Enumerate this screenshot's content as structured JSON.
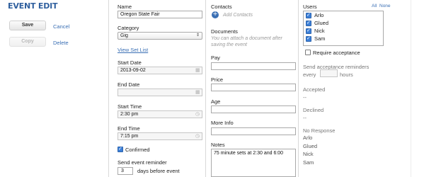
{
  "header": {
    "title": "EVENT EDIT"
  },
  "actions": {
    "save_label": "Save",
    "cancel_label": "Cancel",
    "copy_label": "Copy",
    "delete_label": "Delete"
  },
  "form": {
    "name_label": "Name",
    "name_value": "Oregon State Fair",
    "category_label": "Category",
    "category_value": "Gig",
    "view_set_list": "View Set List",
    "start_date_label": "Start Date",
    "start_date_value": "2013-09-02",
    "end_date_label": "End Date",
    "end_date_value": "",
    "start_time_label": "Start Time",
    "start_time_value": "2:30 pm",
    "end_time_label": "End Time",
    "end_time_value": "7:15 pm",
    "confirmed_label": "Confirmed",
    "confirmed_checked": true,
    "reminder_label": "Send event reminder",
    "reminder_days_value": "3",
    "reminder_suffix": "days before event"
  },
  "middle": {
    "contacts_label": "Contacts",
    "add_contacts": "Add Contacts",
    "documents_label": "Documents",
    "documents_hint_1": "You can attach a document after",
    "documents_hint_2": "saving the event",
    "pay_label": "Pay",
    "price_label": "Price",
    "age_label": "Age",
    "more_info_label": "More Info",
    "notes_label": "Notes",
    "notes_value": "75 minute sets at 2:30 and 6:00"
  },
  "users": {
    "label": "Users",
    "all_link": "All",
    "none_link": "None",
    "list": [
      {
        "name": "Arlo",
        "checked": true
      },
      {
        "name": "Glued",
        "checked": true
      },
      {
        "name": "Nick",
        "checked": true
      },
      {
        "name": "Sam",
        "checked": true
      }
    ],
    "require_acceptance_label": "Require acceptance",
    "send_reminders_label": "Send acceptance reminders",
    "every_label": "every",
    "hours_label": "hours",
    "accepted_label": "Accepted",
    "accepted_value": "--",
    "declined_label": "Declined",
    "declined_value": "--",
    "no_response_label": "No Response",
    "no_response_names": [
      "Arlo",
      "Glued",
      "Nick",
      "Sam"
    ]
  }
}
